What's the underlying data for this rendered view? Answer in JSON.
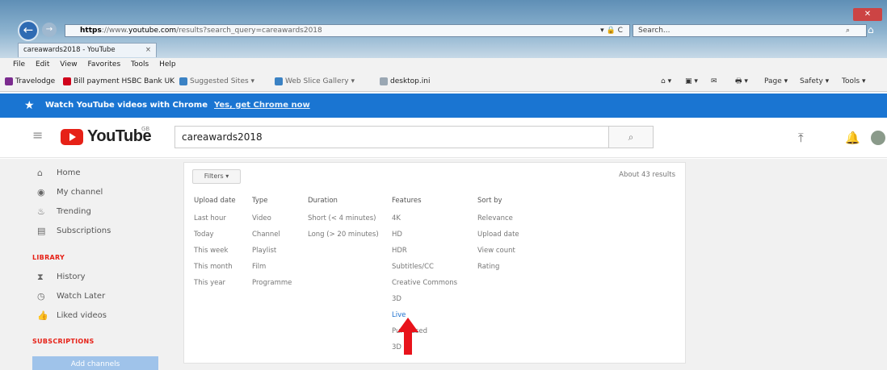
{
  "browser": {
    "address_prefix": "https",
    "address_domain": "youtube.com",
    "address_rest": "/results?search_query=careawards2018",
    "address_controls": "▾ 🔒 C",
    "search_placeholder": "Search...",
    "search_icon": "⌕",
    "tab_title": "careawards2018 - YouTube",
    "tab_close": "×",
    "back_icon": "←",
    "forward_icon": "→",
    "close_window": "✕",
    "home_icon": "⌂",
    "menu": [
      "File",
      "Edit",
      "View",
      "Favorites",
      "Tools",
      "Help"
    ],
    "favorites": [
      {
        "label": "Travelodge",
        "color": "#7b2c8f"
      },
      {
        "label": "Bill payment HSBC Bank UK",
        "color": "#d0021b"
      },
      {
        "label": "Suggested Sites ▾",
        "color": "#3b82c4"
      },
      {
        "label": "Web Slice Gallery ▾",
        "color": "#3b82c4"
      },
      {
        "label": "desktop.ini",
        "color": "#9aa7b3"
      }
    ],
    "commands": [
      "⌂ ▾",
      "▣ ▾",
      "✉",
      "🖶 ▾",
      "Page ▾",
      "Safety ▾",
      "Tools ▾"
    ]
  },
  "banner": {
    "star": "★",
    "text": "Watch YouTube videos with Chrome",
    "link": "Yes, get Chrome now"
  },
  "header": {
    "menu_icon": "≡",
    "logo_text": "YouTube",
    "region": "GB",
    "search_value": "careawards2018",
    "search_btn_icon": "⌕",
    "upload_icon": "⤒",
    "bell_icon": "🔔"
  },
  "sidebar": {
    "items": [
      {
        "icon": "⌂",
        "label": "Home"
      },
      {
        "icon": "◉",
        "label": "My channel"
      },
      {
        "icon": "♨",
        "label": "Trending"
      },
      {
        "icon": "▤",
        "label": "Subscriptions"
      }
    ],
    "library_heading": "LIBRARY",
    "library_items": [
      {
        "icon": "⧗",
        "label": "History"
      },
      {
        "icon": "◷",
        "label": "Watch Later"
      },
      {
        "icon": "👍",
        "label": "Liked videos"
      }
    ],
    "subscriptions_heading": "SUBSCRIPTIONS",
    "add_channels": "Add channels"
  },
  "filters": {
    "button_label": "Filters ▾",
    "results_count": "About 43 results",
    "columns": [
      {
        "heading": "Upload date",
        "options": [
          "Last hour",
          "Today",
          "This week",
          "This month",
          "This year"
        ]
      },
      {
        "heading": "Type",
        "options": [
          "Video",
          "Channel",
          "Playlist",
          "Film",
          "Programme"
        ]
      },
      {
        "heading": "Duration",
        "options": [
          "Short (< 4 minutes)",
          "Long (> 20 minutes)"
        ]
      },
      {
        "heading": "Features",
        "options": [
          "4K",
          "HD",
          "HDR",
          "Subtitles/CC",
          "Creative Commons",
          "3D",
          "Live",
          "Purchased",
          "3D"
        ],
        "selected_index": 6
      },
      {
        "heading": "Sort by",
        "options": [
          "Relevance",
          "Upload date",
          "View count",
          "Rating"
        ]
      }
    ]
  },
  "overlay": {
    "arrow_color": "#e8131b"
  }
}
